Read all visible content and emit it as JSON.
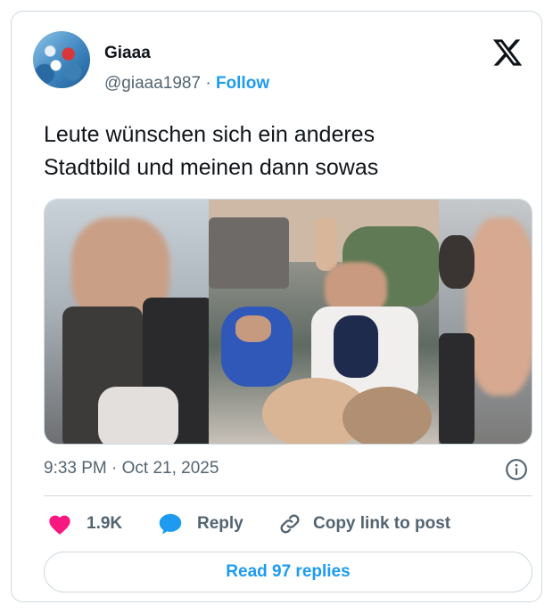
{
  "author": {
    "name": "Giaaa",
    "handle": "@giaaa1987",
    "separator": "·",
    "follow_label": "Follow"
  },
  "tweet": {
    "text_line1": "Leute wünschen sich ein anderes",
    "text_line2": "Stadtbild und meinen dann sowas",
    "timestamp": "9:33 PM · Oct 21, 2025"
  },
  "actions": {
    "likes": "1.9K",
    "reply_label": "Reply",
    "copy_label": "Copy link to post"
  },
  "read_replies_label": "Read 97 replies",
  "icons": {
    "logo": "x-logo-icon",
    "info": "info-icon",
    "like": "heart-icon",
    "reply": "reply-bubble-icon",
    "copy": "link-icon"
  },
  "colors": {
    "accent": "#1d9bf0",
    "heart": "#f91880",
    "text": "#0f1419",
    "muted": "#536471",
    "border": "#cfd9de"
  }
}
